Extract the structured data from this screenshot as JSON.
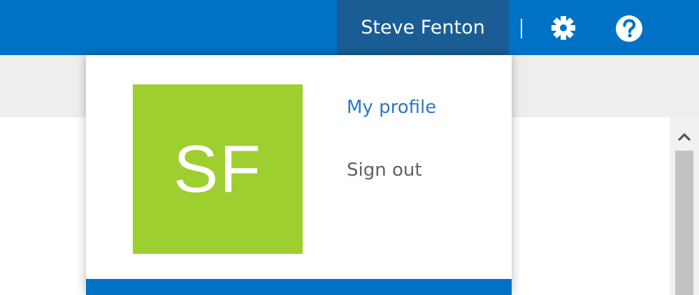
{
  "header": {
    "user_name": "Steve Fenton",
    "divider": "|",
    "settings_icon": "gear-icon",
    "help_icon": "help-icon",
    "colors": {
      "bar": "#0072c6",
      "user_button": "#1a5d94"
    }
  },
  "profile_menu": {
    "avatar_initials": "SF",
    "avatar_color": "#9ecf31",
    "my_profile_label": "My profile",
    "sign_out_label": "Sign out",
    "link_color": "#2a78c8"
  },
  "scrollbar": {
    "up_icon": "chevron-up-icon"
  }
}
